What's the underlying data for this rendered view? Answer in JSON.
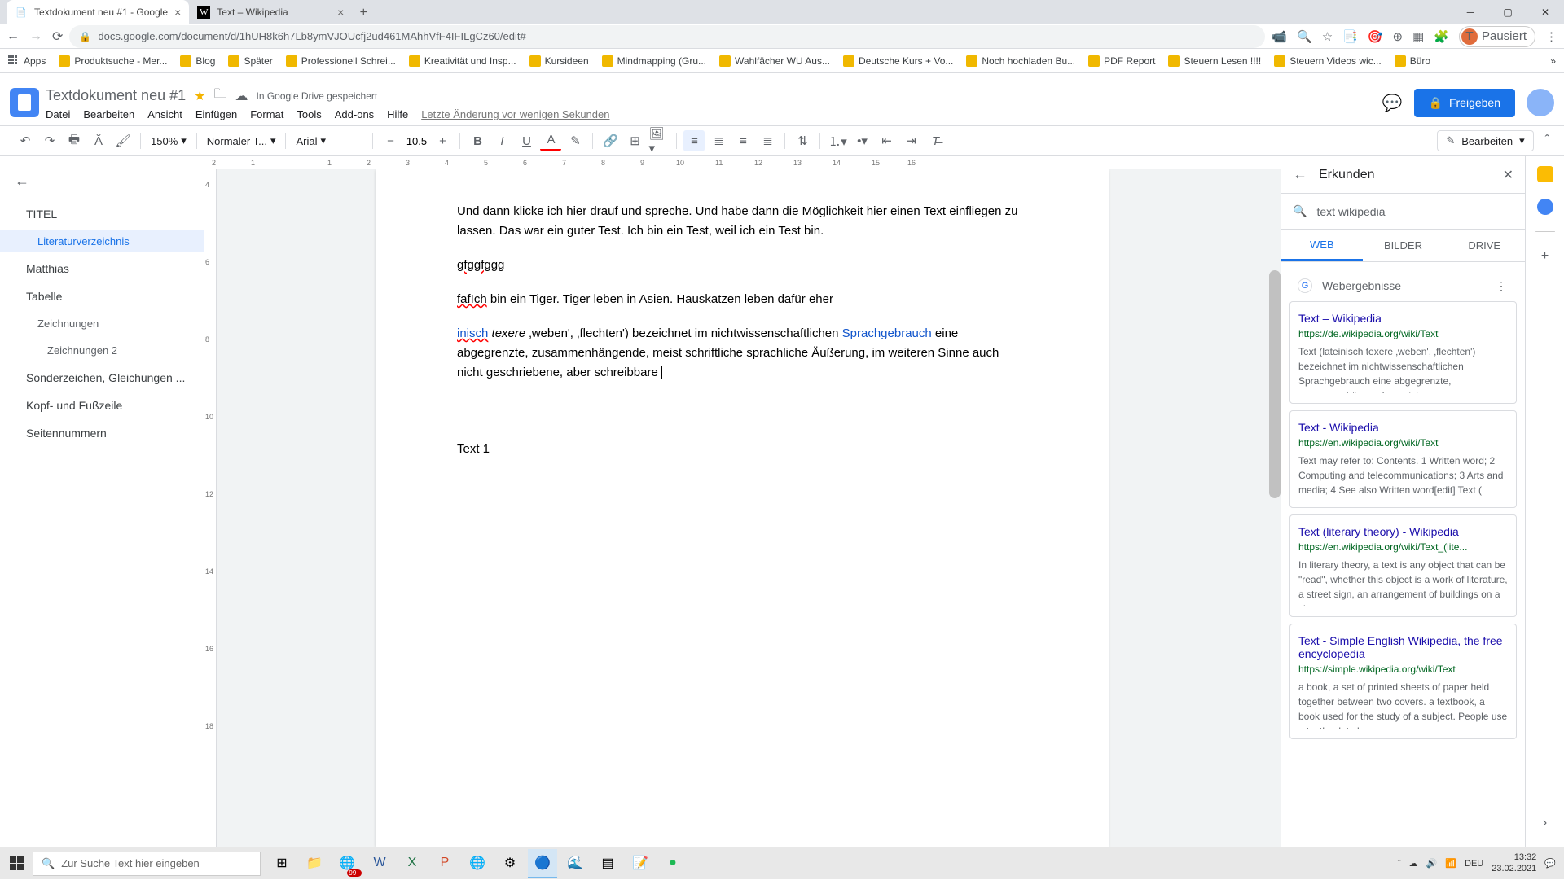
{
  "browser": {
    "tabs": [
      {
        "title": "Textdokument neu #1 - Google",
        "favicon": "📄"
      },
      {
        "title": "Text – Wikipedia",
        "favicon": "W"
      }
    ],
    "url": "docs.google.com/document/d/1hUH8k6h7Lb8ymVJOUcfj2ud461MAhhVfF4IFILgCz60/edit#",
    "pause_label": "Pausiert",
    "avatar_letter": "T"
  },
  "bookmarks": [
    "Apps",
    "Produktsuche - Mer...",
    "Blog",
    "Später",
    "Professionell Schrei...",
    "Kreativität und Insp...",
    "Kursideen",
    "Mindmapping  (Gru...",
    "Wahlfächer WU Aus...",
    "Deutsche Kurs + Vo...",
    "Noch hochladen Bu...",
    "PDF Report",
    "Steuern Lesen !!!!",
    "Steuern Videos wic...",
    "Büro"
  ],
  "docs": {
    "title": "Textdokument neu #1",
    "save_status": "In Google Drive gespeichert",
    "menus": [
      "Datei",
      "Bearbeiten",
      "Ansicht",
      "Einfügen",
      "Format",
      "Tools",
      "Add-ons",
      "Hilfe",
      "Letzte Änderung vor wenigen Sekunden"
    ],
    "share_label": "Freigeben"
  },
  "toolbar": {
    "zoom": "150%",
    "style": "Normaler T...",
    "font": "Arial",
    "size": "10.5",
    "edit_mode": "Bearbeiten"
  },
  "outline": {
    "heading": "TITEL",
    "items": [
      {
        "label": "Literaturverzeichnis",
        "level": 2,
        "active": true
      },
      {
        "label": "Matthias",
        "level": 1
      },
      {
        "label": "Tabelle",
        "level": 1
      },
      {
        "label": "Zeichnungen",
        "level": 2
      },
      {
        "label": "Zeichnungen 2",
        "level": 3
      },
      {
        "label": "Sonderzeichen, Gleichungen ...",
        "level": 1
      },
      {
        "label": "Kopf- und Fußzeile",
        "level": 1
      },
      {
        "label": "Seitennummern",
        "level": 1
      }
    ]
  },
  "document": {
    "para1": "Und dann klicke ich hier drauf und spreche. Und habe dann die Möglichkeit hier einen Text einfliegen zu lassen. Das war ein guter Test. Ich bin ein Test, weil ich ein Test bin.",
    "para2": "gfggfggg",
    "para3_err": "fafIch",
    "para3_rest": " bin ein Tiger. Tiger leben in Asien. Hauskatzen leben dafür eher",
    "para4_link1": "inisch",
    "para4_ital": " texere",
    "para4_mid": " ‚weben', ‚flechten') bezeichnet im nichtwissenschaftlichen ",
    "para4_link2": "Sprachgebrauch",
    "para4_rest": " eine abgegrenzte, zusammenhängende, meist schriftliche sprachliche Äußerung, im weiteren Sinne auch nicht geschriebene, aber schreibbare",
    "para5": "Text 1"
  },
  "ruler_marks": [
    "2",
    "1",
    "",
    "1",
    "2",
    "3",
    "4",
    "5",
    "6",
    "7",
    "8",
    "9",
    "10",
    "11",
    "12",
    "13",
    "14",
    "15",
    "16",
    "1"
  ],
  "vruler_marks": [
    "4",
    "6",
    "8",
    "10",
    "12",
    "14",
    "16",
    "18"
  ],
  "explore": {
    "title": "Erkunden",
    "query": "text wikipedia",
    "tabs": [
      "WEB",
      "BILDER",
      "DRIVE"
    ],
    "source_label": "Webergebnisse",
    "results": [
      {
        "title": "Text – Wikipedia",
        "url": "https://de.wikipedia.org/wiki/Text",
        "snippet": "Text (lateinisch texere ‚weben', ‚flechten') bezeichnet im nichtwissenschaftlichen Sprachgebrauch eine abgegrenzte, zusammenhängende, meist"
      },
      {
        "title": "Text - Wikipedia",
        "url": "https://en.wikipedia.org/wiki/Text",
        "snippet": "Text may refer to: Contents. 1 Written word; 2 Computing and telecommunications; 3 Arts and media; 4 See also  Written word[edit]  Text ("
      },
      {
        "title": "Text (literary theory) - Wikipedia",
        "url": "https://en.wikipedia.org/wiki/Text_(lite...",
        "snippet": "In literary theory, a text is any object that can be \"read\", whether this object is a work of literature, a street sign, an arrangement of buildings on a city"
      },
      {
        "title": "Text - Simple English Wikipedia, the free encyclopedia",
        "url": "https://simple.wikipedia.org/wiki/Text",
        "snippet": "a book, a set of printed sheets of paper held together between two covers. a textbook, a book used for the study of a subject. People use a textbook to learn"
      }
    ]
  },
  "taskbar": {
    "search_placeholder": "Zur Suche Text hier eingeben",
    "badge": "99+",
    "lang": "DEU",
    "time": "13:32",
    "date": "23.02.2021"
  }
}
